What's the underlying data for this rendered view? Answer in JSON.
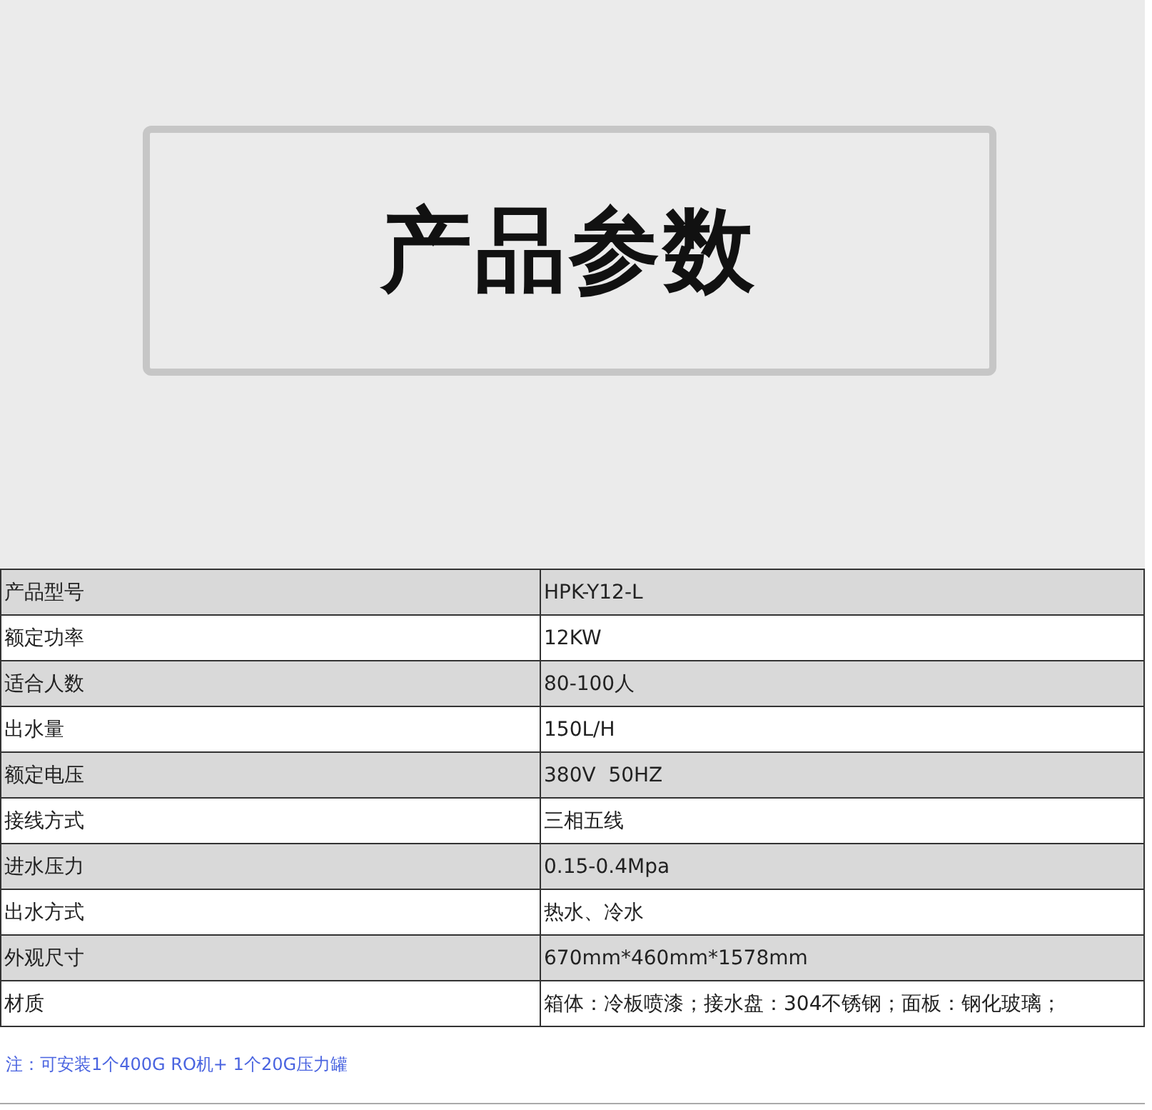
{
  "banner": {
    "title": "产品参数"
  },
  "specs": [
    {
      "label": "产品型号",
      "value": "HPK-Y12-L"
    },
    {
      "label": "额定功率",
      "value": "12KW"
    },
    {
      "label": "适合人数",
      "value": "80-100人"
    },
    {
      "label": "出水量",
      "value": "150L/H"
    },
    {
      "label": "额定电压",
      "value": "380V  50HZ"
    },
    {
      "label": "接线方式",
      "value": "三相五线"
    },
    {
      "label": "进水压力",
      "value": "0.15-0.4Mpa"
    },
    {
      "label": "出水方式",
      "value": "热水、冷水"
    },
    {
      "label": "外观尺寸",
      "value": "670mm*460mm*1578mm"
    },
    {
      "label": "材质",
      "value": "箱体：冷板喷漆；接水盘：304不锈钢；面板：钢化玻璃；"
    }
  ],
  "note": "注：可安装1个400G RO机+ 1个20G压力罐"
}
